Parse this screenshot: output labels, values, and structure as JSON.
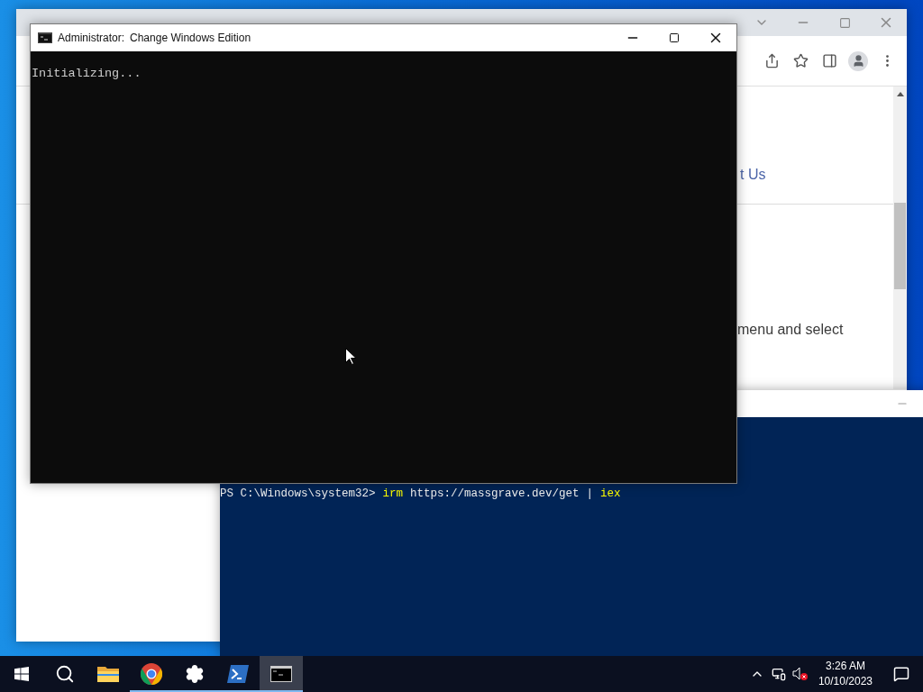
{
  "browser": {
    "page_texts": [
      {
        "text": "t Us",
        "kind": "link"
      },
      {
        "text": "menu and select",
        "kind": "body"
      }
    ]
  },
  "cmd_window": {
    "title_prefix": "Administrator:",
    "title": "Change Windows Edition",
    "output": "Initializing..."
  },
  "powershell_window": {
    "command_line": [
      {
        "text": "PS C:\\Windows\\system32>",
        "kind": "prompt"
      },
      {
        "text": "irm",
        "kind": "command"
      },
      {
        "text": "https://massgrave.dev/get",
        "kind": "argument"
      },
      {
        "text": "|",
        "kind": "operator"
      },
      {
        "text": "iex",
        "kind": "command"
      }
    ]
  },
  "taskbar": {
    "apps": [
      {
        "kind": "explorer",
        "running": false,
        "selected": false
      },
      {
        "kind": "chrome",
        "running": true,
        "selected": false
      },
      {
        "kind": "settings",
        "running": true,
        "selected": false
      },
      {
        "kind": "powershell",
        "running": true,
        "selected": false
      },
      {
        "kind": "cmd",
        "running": true,
        "selected": true
      }
    ],
    "clock": {
      "time": "3:26 AM",
      "date": "10/10/2023"
    }
  }
}
